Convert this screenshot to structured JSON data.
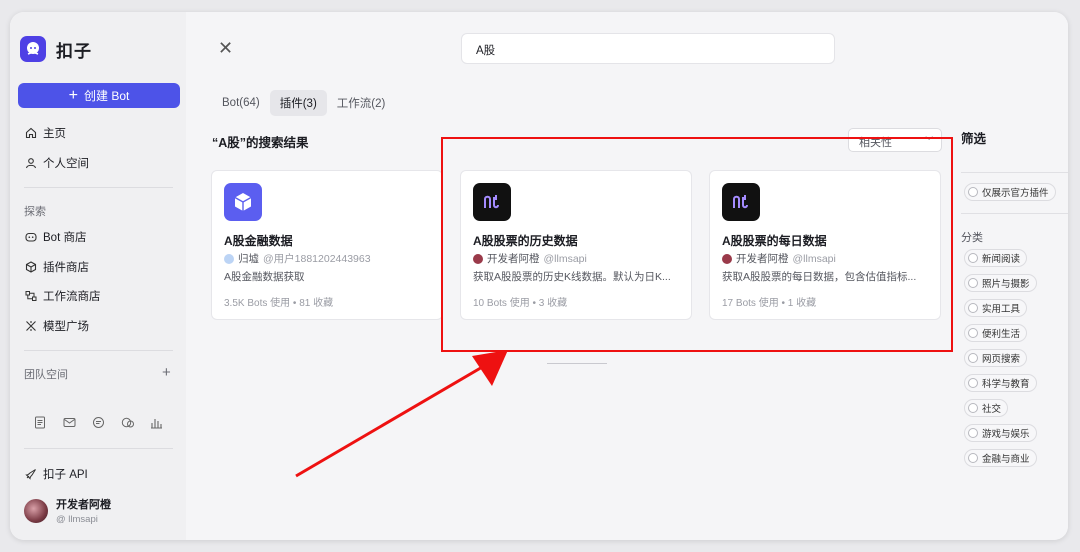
{
  "sidebar": {
    "brand": "扣子",
    "create_button": "创建 Bot",
    "nav": [
      {
        "label": "主页",
        "icon": "home-icon"
      },
      {
        "label": "个人空间",
        "icon": "user-icon"
      }
    ],
    "explore_label": "探索",
    "explore": [
      {
        "label": "Bot 商店",
        "icon": "bot-icon"
      },
      {
        "label": "插件商店",
        "icon": "cube-icon"
      },
      {
        "label": "工作流商店",
        "icon": "workflow-icon"
      },
      {
        "label": "模型广场",
        "icon": "model-icon"
      }
    ],
    "team_label": "团队空间",
    "api_label": "扣子 API",
    "user": {
      "name": "开发者阿橙",
      "handle": "@ llmsapi"
    }
  },
  "main": {
    "search_value": "A股",
    "tabs": [
      {
        "label": "Bot(64)",
        "active": false
      },
      {
        "label": "插件(3)",
        "active": true
      },
      {
        "label": "工作流(2)",
        "active": false
      }
    ],
    "results_title": "“A股”的搜索结果",
    "sort_value": "相关性",
    "cards": [
      {
        "title": "A股金融数据",
        "author": "归墟",
        "handle": "@用户1881202443963",
        "desc": "A股金融数据获取",
        "stats": "3.5K Bots 使用 • 81 收藏",
        "icon": "cube-icon",
        "icon_bg": "#5b5ef0"
      },
      {
        "title": "A股股票的历史数据",
        "author": "开发者阿橙",
        "handle": "@llmsapi",
        "desc": "获取A股股票的历史K线数据。默认为日K...",
        "stats": "10 Bots 使用 • 3 收藏",
        "icon": "api-logo-icon",
        "icon_bg": "#111111"
      },
      {
        "title": "A股股票的每日数据",
        "author": "开发者阿橙",
        "handle": "@llmsapi",
        "desc": "获取A股股票的每日数据，包含估值指标...",
        "stats": "17 Bots 使用 • 1 收藏",
        "icon": "api-logo-icon",
        "icon_bg": "#111111"
      }
    ]
  },
  "filter": {
    "title": "筛选",
    "official_only": "仅展示官方插件",
    "category_label": "分类",
    "categories": [
      "新闻阅读",
      "照片与摄影",
      "实用工具",
      "便利生活",
      "网页搜索",
      "科学与教育",
      "社交",
      "游戏与娱乐",
      "金融与商业"
    ]
  },
  "colors": {
    "accent": "#4d53e8",
    "annotation": "#ee1111"
  }
}
